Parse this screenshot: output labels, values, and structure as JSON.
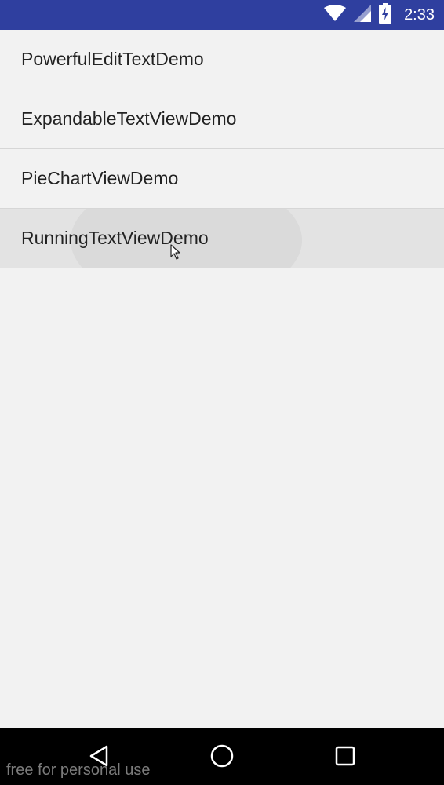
{
  "status_bar": {
    "time": "2:33",
    "icons": [
      "wifi-icon",
      "signal-icon",
      "battery-charging-icon"
    ],
    "background": "#2f3f9f"
  },
  "list": {
    "items": [
      {
        "label": "PowerfulEditTextDemo"
      },
      {
        "label": "ExpandableTextViewDemo"
      },
      {
        "label": "PieChartViewDemo"
      },
      {
        "label": "RunningTextViewDemo",
        "pressed": true
      }
    ]
  },
  "nav_bar": {
    "icons": [
      "back-icon",
      "home-icon",
      "recents-icon"
    ],
    "background": "#000000"
  },
  "watermark": {
    "text": "free for personal use"
  }
}
